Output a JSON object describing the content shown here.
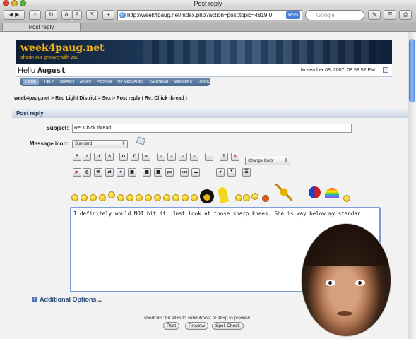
{
  "window": {
    "title": "Post reply"
  },
  "browser": {
    "url": "http://week4paug.net/index.php?action=post;topic=4819.0",
    "rss_label": "RSS",
    "search_placeholder": "Google",
    "tab_label": "Post reply"
  },
  "site": {
    "logo_text": "week4paug.net",
    "tagline": "sharin our groove with you",
    "hello_label": "Hello",
    "username": "August",
    "datetime": "November 08, 2007, 08:59:52 PM",
    "nav": [
      "HOME",
      "HELP",
      "SEARCH",
      "ADMIN",
      "PROFILE",
      "MY MESSAGES",
      "CALENDAR",
      "MEMBERS",
      "LOGOUT"
    ]
  },
  "breadcrumb": "week4paug.net > Red Light District > Sex > Post reply ( Re: Chick thread )",
  "form": {
    "panel_title": "Post reply",
    "subject_label": "Subject:",
    "subject_value": "Re: Chick thread",
    "icon_label": "Message icon:",
    "icon_value": "Standard",
    "color_select": "Change Color",
    "message": "I definitely would NOT hit it.  Just look at those sharp knees.  She is way below my standar",
    "additional_options": "Additional Options...",
    "shortcuts": "shortcuts: hit alt+s to submit/post or alt+p to preview",
    "buttons": {
      "post": "Post",
      "preview": "Preview",
      "spell": "Spell Check"
    }
  },
  "format_buttons_row1": [
    "B",
    "I",
    "U",
    "S",
    "G",
    "D",
    "↵",
    "≡",
    "≡",
    "≡",
    "≡",
    "↔",
    "T",
    "A"
  ],
  "format_buttons_row2": [
    "▶",
    "◎",
    "✉",
    "⇄",
    "■",
    "▦",
    "▦",
    "▦",
    "pp",
    "sub",
    "▬",
    "#",
    "❞",
    "☰"
  ],
  "colors": {
    "accent": "#7a9fd6",
    "nav": "#48698f",
    "logo": "#f0b41c"
  }
}
